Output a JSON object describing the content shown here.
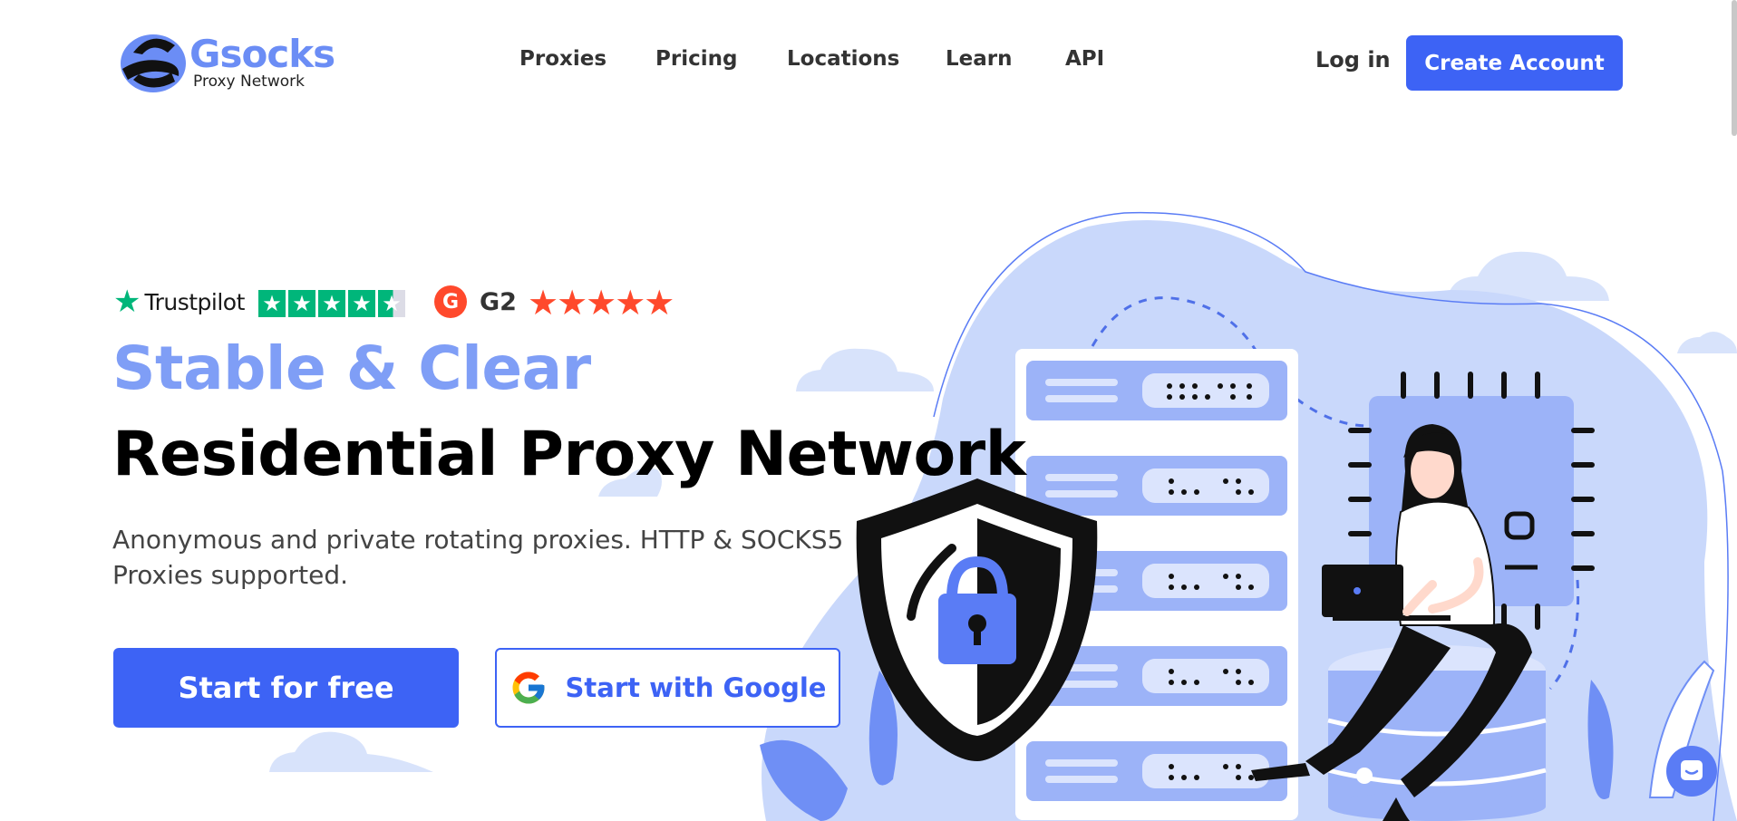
{
  "brand": {
    "name": "Gsocks",
    "tagline": "Proxy Network"
  },
  "nav": {
    "items": [
      {
        "label": "Proxies"
      },
      {
        "label": "Pricing"
      },
      {
        "label": "Locations"
      },
      {
        "label": "Learn"
      },
      {
        "label": "API"
      }
    ]
  },
  "header": {
    "login_label": "Log in",
    "create_account_label": "Create Account"
  },
  "ratings": {
    "trustpilot_name": "Trustpilot",
    "trustpilot_stars": 4.5,
    "g2_badge": "G",
    "g2_name": "G2",
    "g2_stars": 5
  },
  "hero": {
    "subtitle": "Stable & Clear",
    "title": "Residential Proxy Network",
    "description": "Anonymous and private rotating proxies. HTTP & SOCKS5 Proxies supported.",
    "primary_cta": "Start for free",
    "google_cta": "Start with Google"
  },
  "colors": {
    "accent": "#3d63f5",
    "light_accent": "#7f9ef6",
    "trustpilot_green": "#00b67a",
    "g2_red": "#ff492c"
  },
  "icons": {
    "chat": "chat-icon",
    "google": "google-icon",
    "shield": "shield-lock-icon"
  }
}
